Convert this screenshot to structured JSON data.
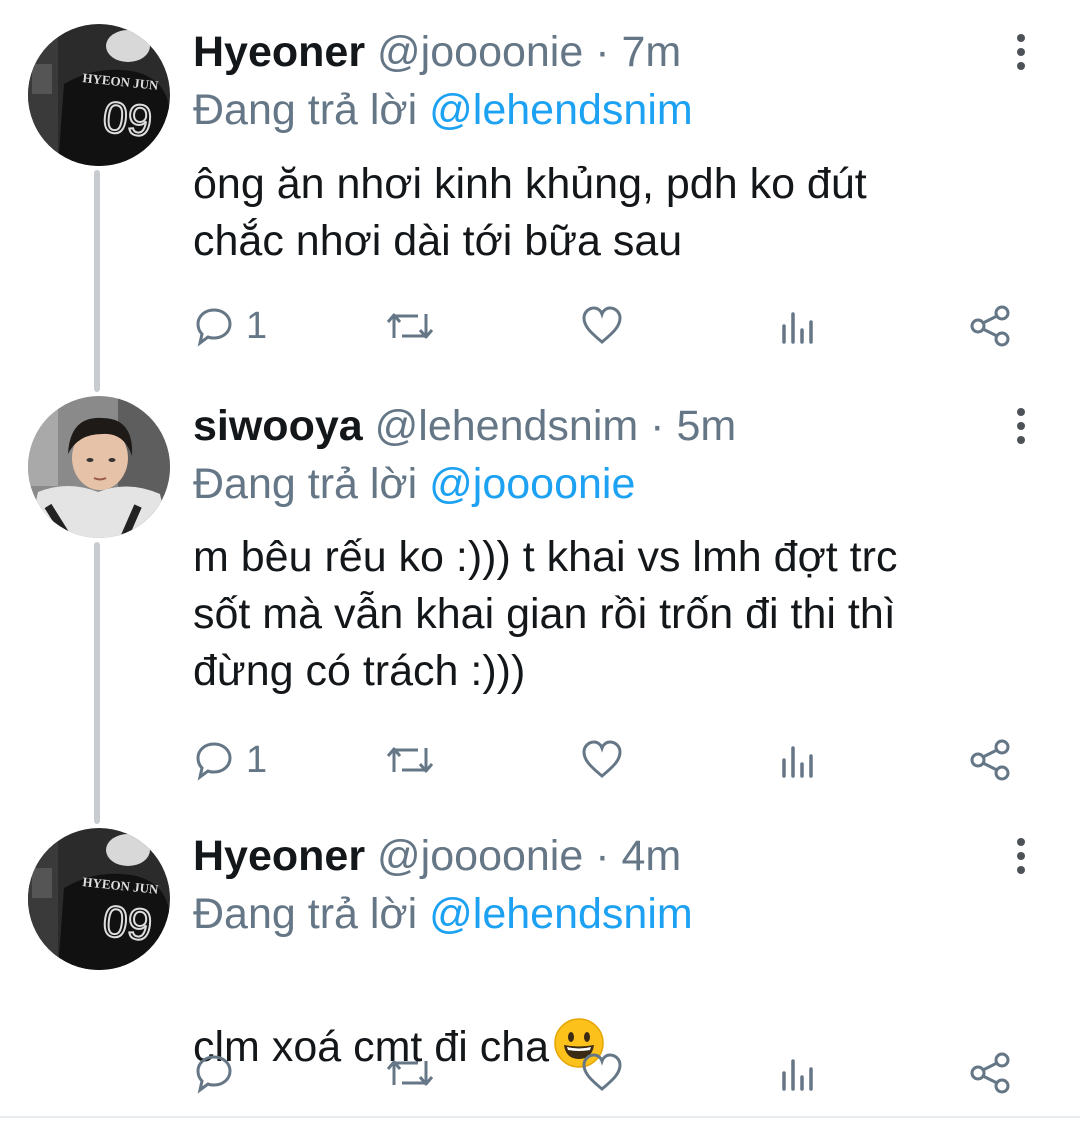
{
  "colors": {
    "text": "#14171a",
    "muted": "#657786",
    "link": "#1da1f2",
    "thread_line": "#c8ccd0"
  },
  "tweets": [
    {
      "display_name": "Hyeoner",
      "handle": "@joooonie",
      "dot": "·",
      "time": "7m",
      "reply_prefix": "Đang trả lời",
      "reply_to": "@lehendsnim",
      "text": "ông ăn nhơi kinh khủng, pdh ko đút\nchắc nhơi dài tới bữa sau",
      "reply_count": "1",
      "avatar_jersey_name": "HYEON JUN",
      "avatar_jersey_number": "09"
    },
    {
      "display_name": "siwooya",
      "handle": "@lehendsnim",
      "dot": "·",
      "time": "5m",
      "reply_prefix": "Đang trả lời",
      "reply_to": "@joooonie",
      "text": "m bêu rếu ko :))) t khai vs lmh đợt trc\nsốt mà vẫn khai gian rồi trốn đi thi thì\nđừng có trách :)))",
      "reply_count": "1"
    },
    {
      "display_name": "Hyeoner",
      "handle": "@joooonie",
      "dot": "·",
      "time": "4m",
      "reply_prefix": "Đang trả lời",
      "reply_to": "@lehendsnim",
      "text": "clm xoá cmt đi cha",
      "emoji": "grinning-face-emoji",
      "reply_count": "",
      "avatar_jersey_name": "HYEON JUN",
      "avatar_jersey_number": "09"
    }
  ],
  "icons": {
    "reply": "reply-icon",
    "retweet": "retweet-icon",
    "like": "heart-icon",
    "analytics": "analytics-icon",
    "share": "share-icon",
    "more": "more-vertical-icon"
  }
}
